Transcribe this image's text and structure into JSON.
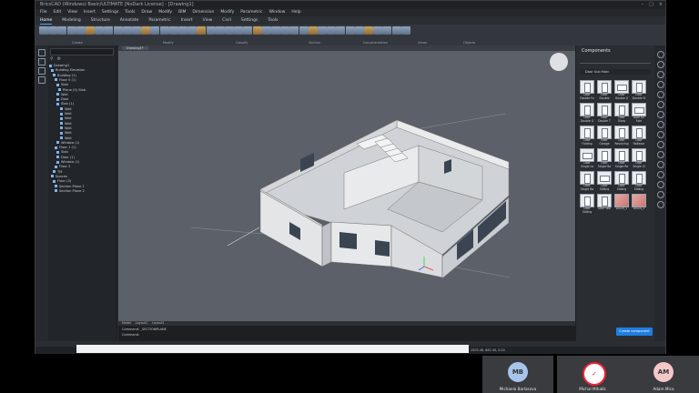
{
  "app": {
    "title": "BricsCAD (Windows) Basic/ULTIMATE [NoDark License] - [Drawing1]",
    "menu": [
      "File",
      "Edit",
      "View",
      "Insert",
      "Settings",
      "Tools",
      "Draw",
      "Modify",
      "BIM",
      "Dimension",
      "Modify",
      "Parametric",
      "Window",
      "Help"
    ],
    "ribbon_tabs": [
      "Home",
      "Modeling",
      "Structure",
      "Annotate",
      "Parametric",
      "Insert",
      "View",
      "Civil",
      "Settings",
      "Tools"
    ],
    "ribbon_groups": [
      "Create",
      "Modify",
      "Classify",
      "Section",
      "Documentation",
      "Views",
      "Objects"
    ],
    "viewport_tab": "Drawing1*",
    "command_lines": [
      "Command: _SECTIONPLANE",
      "Command:"
    ],
    "command_tabs": [
      "Model",
      "Layout1",
      "Layout2"
    ],
    "status": "2005.48, 862.40, 0.00"
  },
  "tree": {
    "search_placeholder": "",
    "rows": [
      "Drawing1",
      "Building Elevation",
      "Building (1)",
      "Floor 0 (1)",
      "Slab",
      "Plane (0) Slab",
      "Wall",
      "Door",
      "Slab (1)",
      "Wall",
      "Wall",
      "Wall",
      "Wall",
      "Wall",
      "Wall",
      "Wall",
      "Window (1)",
      "Floor 1 (1)",
      "Slab",
      "Door (1)",
      "Window (1)",
      "Floor 2",
      "TM",
      "Spaces",
      "Floor (3)",
      "Section Plane 1",
      "Section Plane 2"
    ]
  },
  "components": {
    "title": "Components",
    "category": "Door Sub Main",
    "tiles": [
      "Door Double Fo",
      "Door Double",
      "Door Double G",
      "Door Double Sl",
      "Door Double G",
      "Door Double T",
      "Door Glass",
      "Door Bif Fold",
      "Door Folding",
      "Door Garage",
      "Door Revolving",
      "Door Rolldoor",
      "Door Single Lo",
      "Door Single Ba",
      "Door Single Re",
      "Door Single Sl",
      "Door Single Ba",
      "Door Sliding",
      "Door Sliding",
      "Door Sliding",
      "Door Sliding",
      "Door Wal",
      "DSGN_1",
      "DSGN_2"
    ],
    "create_button": "Create component"
  },
  "meeting": {
    "participants": [
      {
        "initials": "MB",
        "name": "Michaela Barlasova",
        "color": "#a7c4ea"
      },
      {
        "initials": "",
        "name": "Michal Mihalik",
        "color": "#ffffff"
      },
      {
        "initials": "AM",
        "name": "Adam Mica",
        "color": "#f4c7c9"
      }
    ]
  }
}
